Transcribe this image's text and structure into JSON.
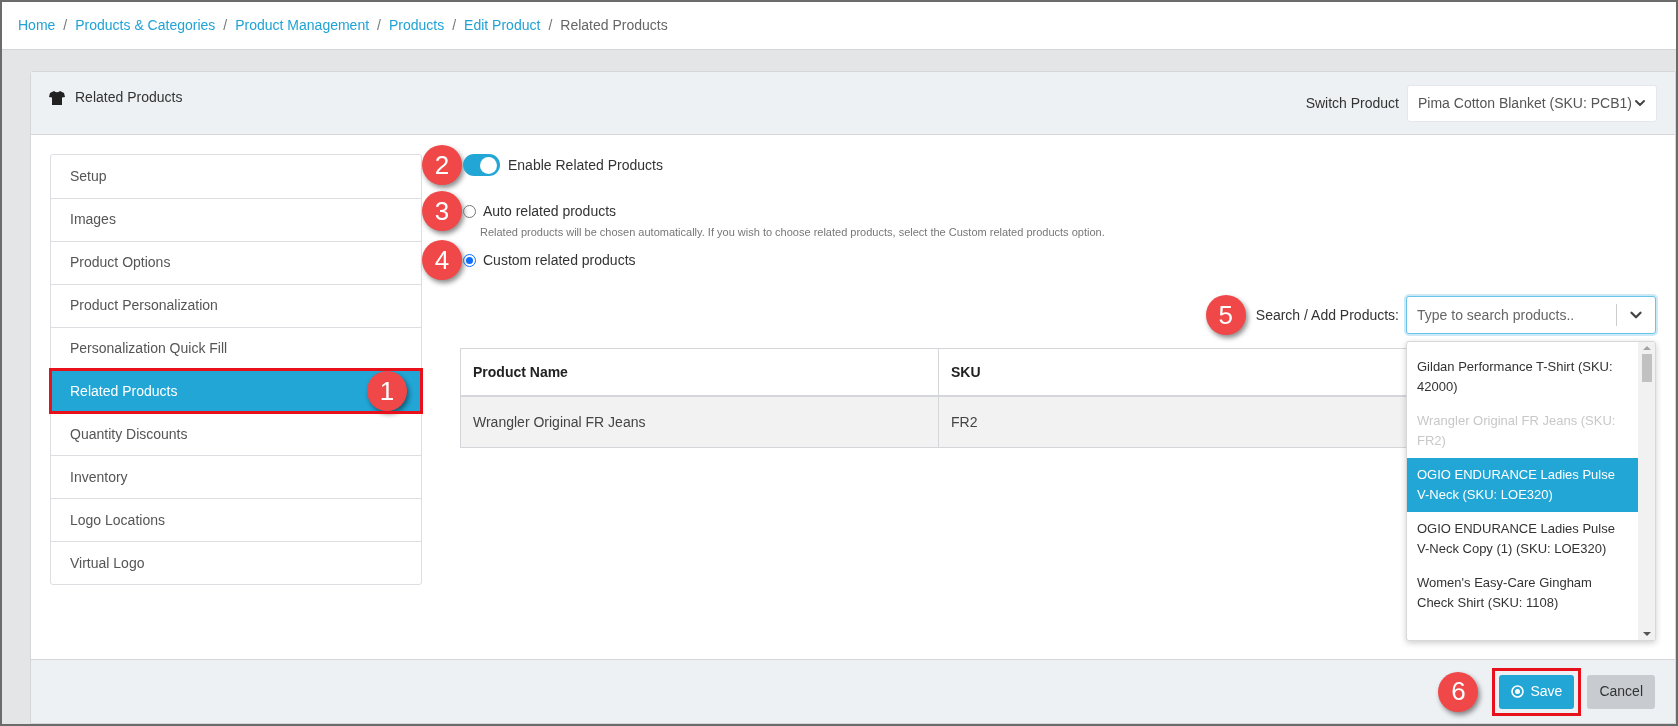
{
  "breadcrumb": [
    {
      "label": "Home",
      "current": false
    },
    {
      "label": "Products & Categories",
      "current": false
    },
    {
      "label": "Product Management",
      "current": false
    },
    {
      "label": "Products",
      "current": false
    },
    {
      "label": "Edit Product",
      "current": false
    },
    {
      "label": "Related Products",
      "current": true
    }
  ],
  "breadcrumb_separator": "/",
  "panel": {
    "title": "Related Products",
    "switch_label": "Switch Product",
    "switch_value": "Pima Cotton Blanket (SKU: PCB1)"
  },
  "sidebar": {
    "items": [
      {
        "label": "Setup",
        "selected": false,
        "highlighted": false
      },
      {
        "label": "Images",
        "selected": false,
        "highlighted": false
      },
      {
        "label": "Product Options",
        "selected": false,
        "highlighted": false
      },
      {
        "label": "Product Personalization",
        "selected": false,
        "highlighted": false
      },
      {
        "label": "Personalization Quick Fill",
        "selected": false,
        "highlighted": false
      },
      {
        "label": "Related Products",
        "selected": true,
        "highlighted": true,
        "callout": "1"
      },
      {
        "label": "Quantity Discounts",
        "selected": false,
        "highlighted": false
      },
      {
        "label": "Inventory",
        "selected": false,
        "highlighted": false
      },
      {
        "label": "Logo Locations",
        "selected": false,
        "highlighted": false
      },
      {
        "label": "Virtual Logo",
        "selected": false,
        "highlighted": false
      }
    ]
  },
  "toggle": {
    "label": "Enable Related Products",
    "on": true,
    "callout": "2"
  },
  "radios": [
    {
      "label": "Auto related products",
      "selected": false,
      "callout": "3",
      "hint": "Related products will be chosen automatically. If you wish to choose related products, select the Custom related products option."
    },
    {
      "label": "Custom related products",
      "selected": true,
      "callout": "4"
    }
  ],
  "search": {
    "label": "Search / Add Products:",
    "placeholder": "Type to search products..",
    "callout": "5"
  },
  "table": {
    "columns": [
      "Product Name",
      "SKU"
    ],
    "rows": [
      [
        "Wrangler Original FR Jeans",
        "FR2"
      ]
    ]
  },
  "dropdown": {
    "options": [
      {
        "label": "Gildan Performance T-Shirt (SKU: 42000)",
        "selected": false,
        "disabled": false
      },
      {
        "label": "Wrangler Original FR Jeans (SKU: FR2)",
        "selected": false,
        "disabled": true
      },
      {
        "label": "OGIO ENDURANCE Ladies Pulse V-Neck (SKU: LOE320)",
        "selected": true,
        "disabled": false
      },
      {
        "label": "OGIO ENDURANCE Ladies Pulse V-Neck Copy (1) (SKU: LOE320)",
        "selected": false,
        "disabled": false
      },
      {
        "label": "Women's Easy-Care Gingham Check Shirt (SKU: 1108)",
        "selected": false,
        "disabled": false
      }
    ]
  },
  "footer": {
    "buttons": [
      {
        "label": "Save",
        "kind": "primary",
        "highlighted": true,
        "callout": "6"
      },
      {
        "label": "Cancel",
        "kind": "secondary",
        "highlighted": false
      }
    ]
  }
}
